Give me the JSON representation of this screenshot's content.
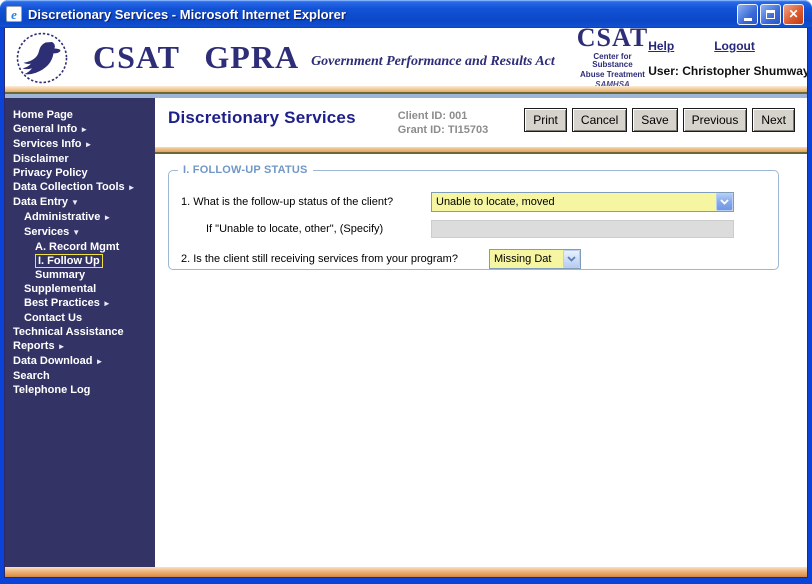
{
  "window": {
    "title": "Discretionary Services - Microsoft Internet Explorer"
  },
  "icons": {
    "ie_e": "e",
    "close": "✕",
    "arrow_right": "►",
    "arrow_down": "▼"
  },
  "header": {
    "logo_title": "CSAT GPRA",
    "logo_subtitle": "Government Performance and Results Act",
    "csat": {
      "acronym": "CSAT",
      "line1": "Center for Substance",
      "line2": "Abuse Treatment",
      "line3": "SAMHSA"
    },
    "links": {
      "help": "Help",
      "logout": "Logout"
    },
    "user": "User: Christopher Shumway"
  },
  "sidebar": {
    "items": [
      {
        "label": "Home Page",
        "level": 0
      },
      {
        "label": "General Info",
        "level": 0,
        "arrow": "right"
      },
      {
        "label": "Services Info",
        "level": 0,
        "arrow": "right"
      },
      {
        "label": "Disclaimer",
        "level": 0
      },
      {
        "label": "Privacy Policy",
        "level": 0
      },
      {
        "label": "Data Collection Tools",
        "level": 0,
        "arrow": "right"
      },
      {
        "label": "Data Entry",
        "level": 0,
        "arrow": "down"
      },
      {
        "label": "Administrative",
        "level": 1,
        "arrow": "right"
      },
      {
        "label": "Services",
        "level": 1,
        "arrow": "down"
      },
      {
        "label": "A. Record Mgmt",
        "level": 2
      },
      {
        "label": "I. Follow Up",
        "level": 2,
        "active": true
      },
      {
        "label": "Summary",
        "level": 2
      },
      {
        "label": "Supplemental",
        "level": 1
      },
      {
        "label": "Best Practices",
        "level": 1,
        "arrow": "right"
      },
      {
        "label": "Contact Us",
        "level": 1
      },
      {
        "label": "Technical Assistance",
        "level": 0
      },
      {
        "label": "Reports",
        "level": 0,
        "arrow": "right"
      },
      {
        "label": "Data Download",
        "level": 0,
        "arrow": "right"
      },
      {
        "label": "Search",
        "level": 0
      },
      {
        "label": "Telephone Log",
        "level": 0
      }
    ]
  },
  "main": {
    "page_title": "Discretionary Services",
    "client_id": "Client ID: 001",
    "grant_id": "Grant ID: TI15703",
    "buttons": [
      "Print",
      "Cancel",
      "Save",
      "Previous",
      "Next"
    ],
    "fieldset": {
      "legend": "I. FOLLOW-UP STATUS",
      "q1": {
        "label": "1. What is the follow-up status of the client?",
        "value": "Unable to locate, moved"
      },
      "specify": {
        "label": "If \"Unable to locate, other\", (Specify)",
        "value": ""
      },
      "q2": {
        "label": "2. Is the client still receiving services from your program?",
        "value": "Missing Dat"
      }
    }
  },
  "colors": {
    "sidebar_navy": "#333366",
    "titlebar_blue": "#1150d2",
    "window_border_blue": "#0b43d9",
    "highlight_yellow": "#f6f6a2",
    "orange_stripe": "#eaa964",
    "olive_line": "#6b6837",
    "steel_legend": "#7097c6",
    "link_navy": "#26267c",
    "id_gray": "#8c8c8c"
  }
}
